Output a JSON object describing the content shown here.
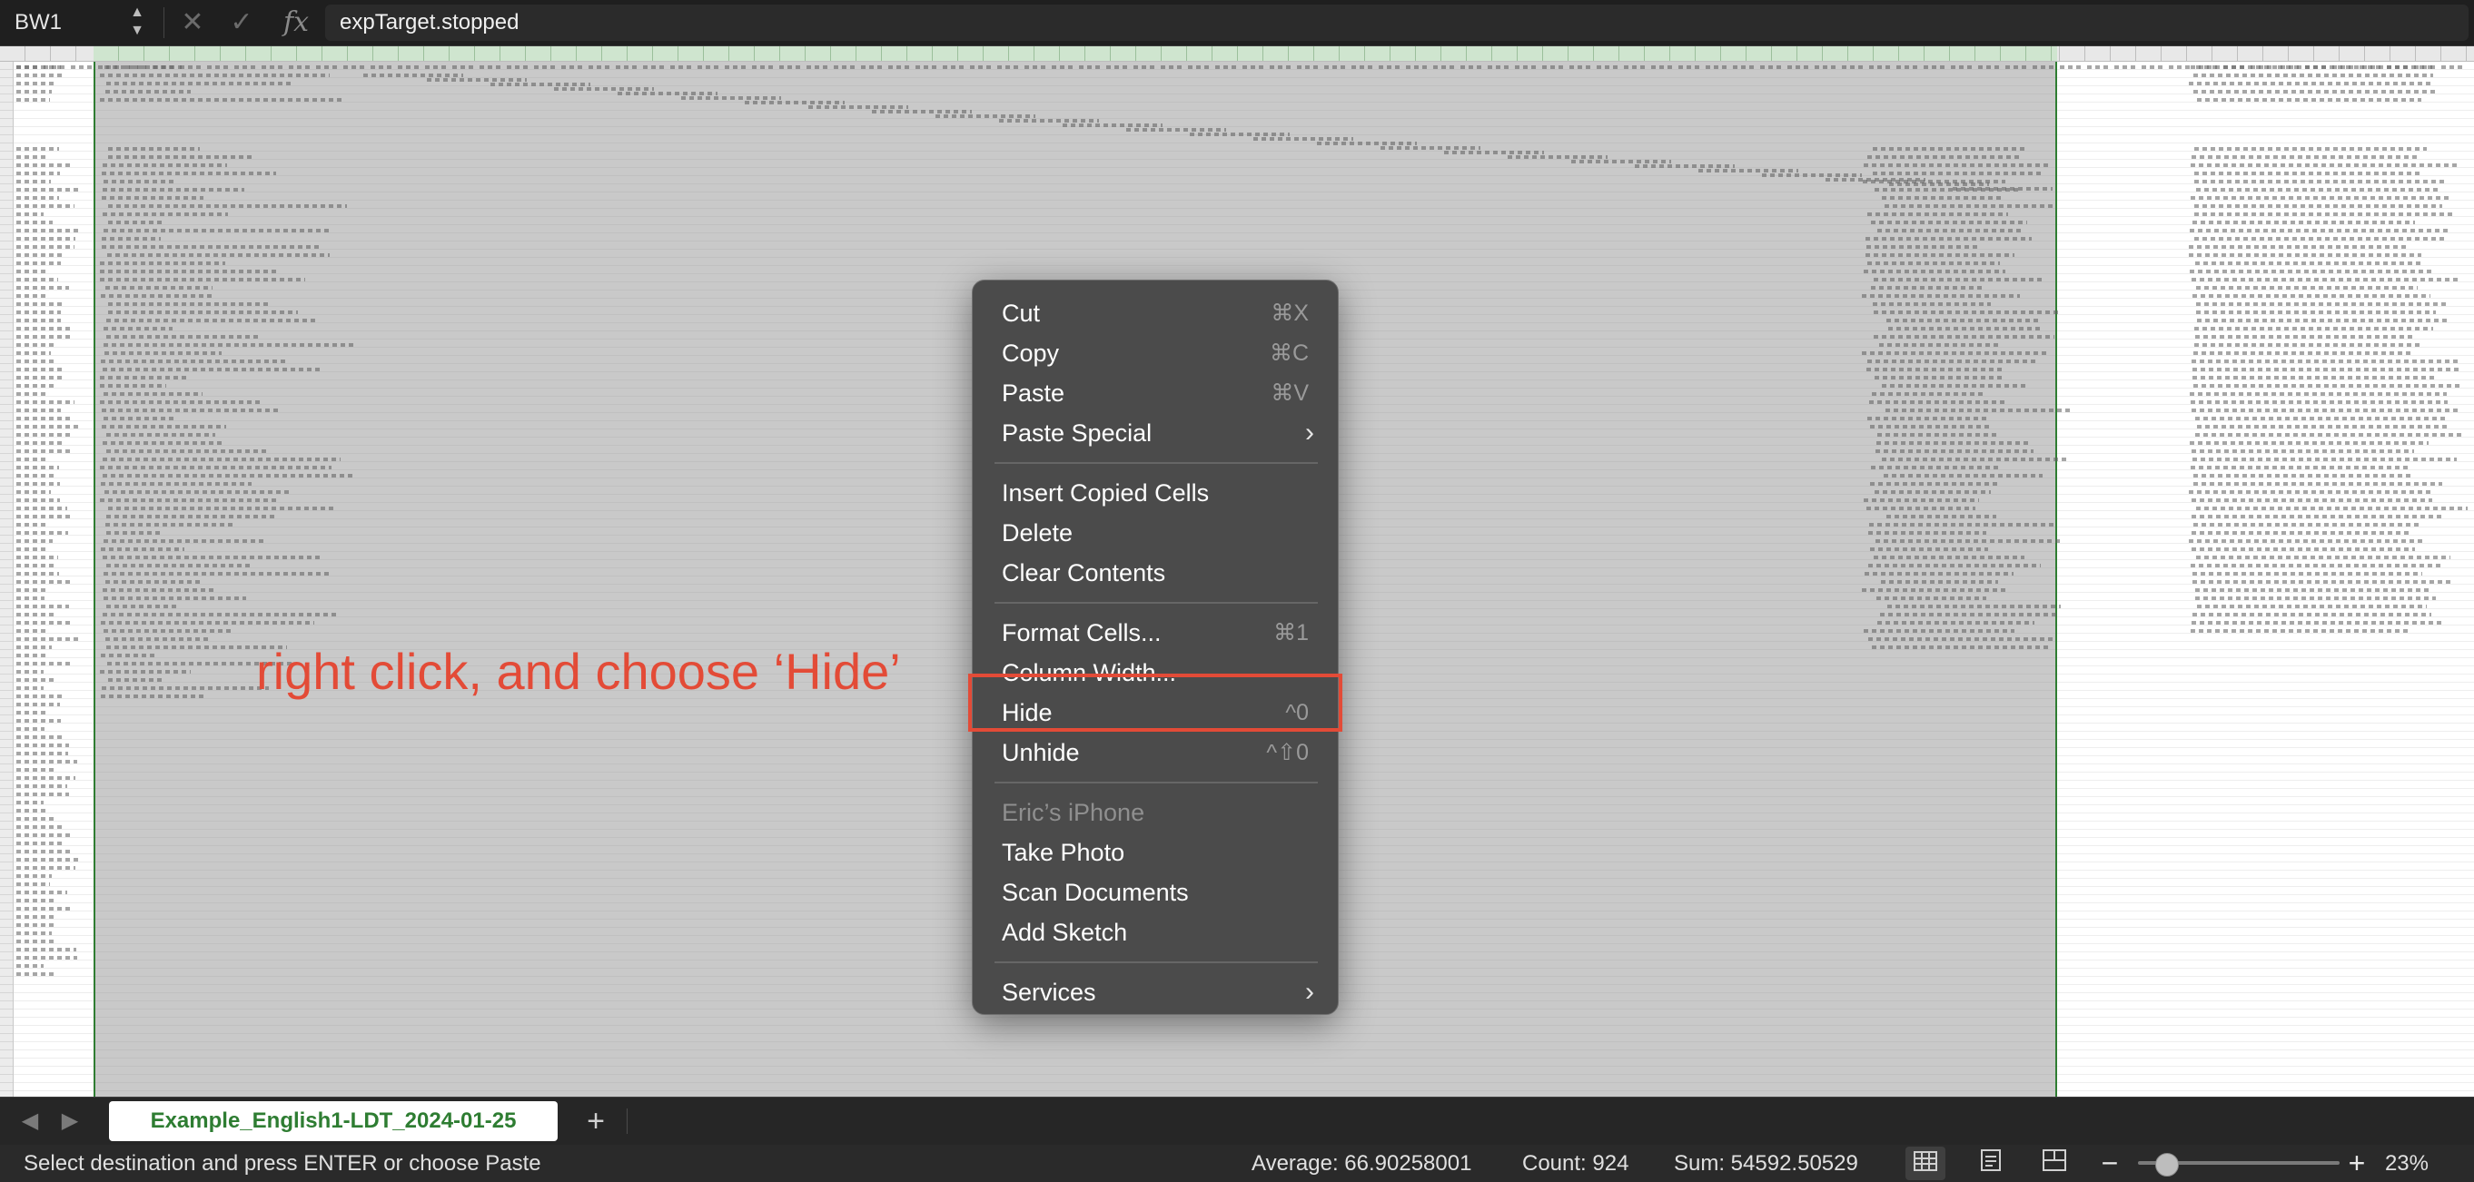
{
  "formula_bar": {
    "name_box": "BW1",
    "stepper": "▲▼",
    "cancel_glyph": "✕",
    "confirm_glyph": "✓",
    "fx_label": "fx",
    "formula": "expTarget.stopped"
  },
  "annotation": {
    "text": "right click, and choose ‘Hide’",
    "color": "#e34b37"
  },
  "context_menu": {
    "groups": [
      [
        {
          "label": "Cut",
          "shortcut": "⌘X"
        },
        {
          "label": "Copy",
          "shortcut": "⌘C"
        },
        {
          "label": "Paste",
          "shortcut": "⌘V"
        },
        {
          "label": "Paste Special",
          "submenu": "›"
        }
      ],
      [
        {
          "label": "Insert Copied Cells"
        },
        {
          "label": "Delete"
        },
        {
          "label": "Clear Contents"
        }
      ],
      [
        {
          "label": "Format Cells...",
          "shortcut": "⌘1"
        },
        {
          "label": "Column Width..."
        },
        {
          "label": "Hide",
          "shortcut": "^0",
          "highlighted": true
        },
        {
          "label": "Unhide",
          "shortcut": "^⇧0"
        }
      ],
      [
        {
          "label": "Eric’s iPhone",
          "disabled": true
        },
        {
          "label": "Take Photo"
        },
        {
          "label": "Scan Documents"
        },
        {
          "label": "Add Sketch"
        }
      ],
      [
        {
          "label": "Services",
          "submenu": "›"
        }
      ]
    ]
  },
  "tab_bar": {
    "prev_glyph": "◀",
    "next_glyph": "▶",
    "active_sheet": "Example_English1-LDT_2024-01-25",
    "add_glyph": "+"
  },
  "status_bar": {
    "message": "Select destination and press ENTER or choose Paste",
    "average": "Average: 66.90258001",
    "count": "Count: 924",
    "sum": "Sum: 54592.50529",
    "zoom_minus": "−",
    "zoom_plus": "+",
    "zoom_level": "23%",
    "zoom_fraction": 0.14
  },
  "colors": {
    "accent_green": "#2e7d32",
    "menu_bg": "#4b4b4b",
    "highlight_red": "#e34b37"
  }
}
